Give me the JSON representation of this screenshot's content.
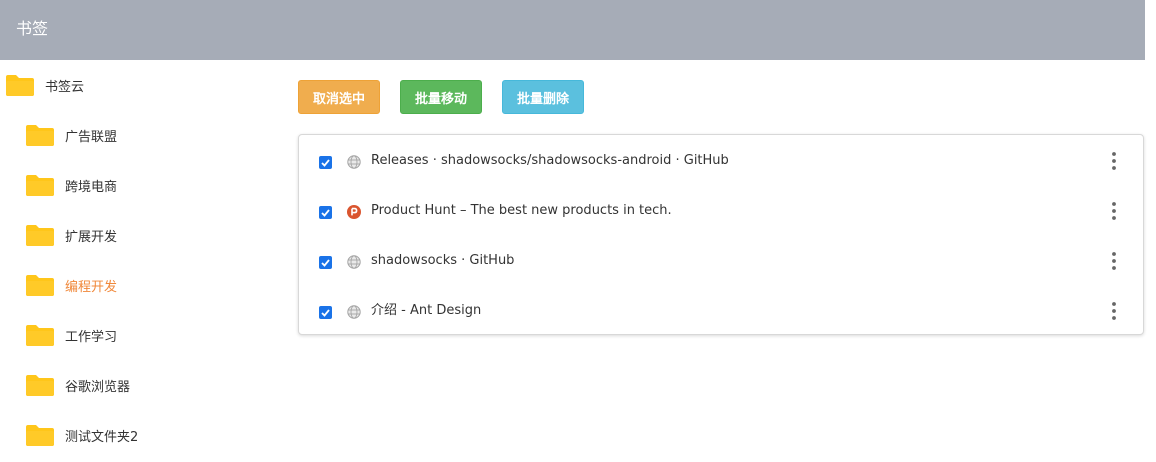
{
  "header": {
    "title": "书签"
  },
  "sidebar": {
    "root": {
      "label": "书签云",
      "icon": "folder-icon"
    },
    "items": [
      {
        "label": "广告联盟",
        "icon": "folder-icon"
      },
      {
        "label": "跨境电商",
        "icon": "folder-icon"
      },
      {
        "label": "扩展开发",
        "icon": "folder-icon"
      },
      {
        "label": "编程开发",
        "icon": "folder-icon",
        "active": true
      },
      {
        "label": "工作学习",
        "icon": "folder-icon"
      },
      {
        "label": "谷歌浏览器",
        "icon": "folder-icon"
      },
      {
        "label": "测试文件夹2",
        "icon": "folder-icon"
      }
    ]
  },
  "toolbar": {
    "cancel_label": "取消选中",
    "move_label": "批量移动",
    "delete_label": "批量删除"
  },
  "bookmarks": [
    {
      "title": "Releases · shadowsocks/shadowsocks-android · GitHub",
      "checked": true,
      "favicon": "globe-icon"
    },
    {
      "title": "Product Hunt – The best new products in tech.",
      "checked": true,
      "favicon": "product-hunt-icon"
    },
    {
      "title": "shadowsocks · GitHub",
      "checked": true,
      "favicon": "globe-icon"
    },
    {
      "title": "介绍 - Ant Design",
      "checked": true,
      "favicon": "globe-icon"
    }
  ],
  "colors": {
    "header_bg": "#a6acb7",
    "active_folder": "#f0883a",
    "folder_yellow": "#ffc61a",
    "btn_cancel": "#f0ad4e",
    "btn_move": "#5cb85c",
    "btn_delete": "#5bc0de",
    "checkbox": "#1a73e8",
    "product_hunt": "#da552f"
  }
}
